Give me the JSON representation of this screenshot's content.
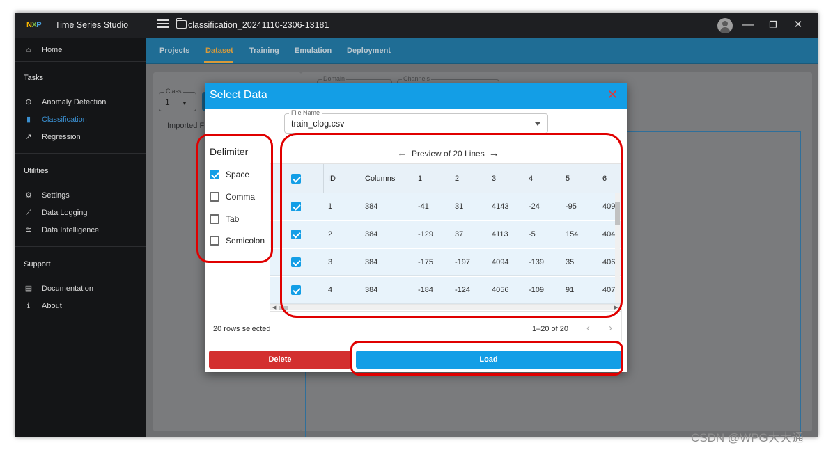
{
  "app": {
    "logo_text": "NXP",
    "title": "Time Series Studio",
    "project_name": "classification_20241110-2306-13181"
  },
  "window_controls": {
    "minimize": "—",
    "maximize": "❐",
    "close": "✕"
  },
  "sidebar": {
    "home": "Home",
    "tasks_header": "Tasks",
    "tasks": [
      "Anomaly Detection",
      "Classification",
      "Regression"
    ],
    "utilities_header": "Utilities",
    "utilities": [
      "Settings",
      "Data Logging",
      "Data Intelligence"
    ],
    "support_header": "Support",
    "support": [
      "Documentation",
      "About"
    ],
    "active_item": "Classification"
  },
  "tabs": [
    "Projects",
    "Dataset",
    "Training",
    "Emulation",
    "Deployment"
  ],
  "active_tab": "Dataset",
  "background": {
    "class_label": "Class",
    "class_value": "1",
    "imported_label": "Imported F",
    "domain_label": "Domain",
    "channels_label": "Channels"
  },
  "dialog": {
    "title": "Select Data",
    "file_name_label": "File Name",
    "file_name_value": "train_clog.csv",
    "delimiter_title": "Delimiter",
    "delimiters": [
      {
        "label": "Space",
        "checked": true
      },
      {
        "label": "Comma",
        "checked": false
      },
      {
        "label": "Tab",
        "checked": false
      },
      {
        "label": "Semicolon",
        "checked": false
      }
    ],
    "preview_label": "Preview of 20 Lines",
    "grid": {
      "columns": [
        "ID",
        "Columns",
        "1",
        "2",
        "3",
        "4",
        "5",
        "6"
      ],
      "rows": [
        [
          "1",
          "384",
          "-41",
          "31",
          "4143",
          "-24",
          "-95",
          "409"
        ],
        [
          "2",
          "384",
          "-129",
          "37",
          "4113",
          "-5",
          "154",
          "404"
        ],
        [
          "3",
          "384",
          "-175",
          "-197",
          "4094",
          "-139",
          "35",
          "406"
        ],
        [
          "4",
          "384",
          "-184",
          "-124",
          "4056",
          "-109",
          "91",
          "407"
        ]
      ]
    },
    "rows_selected": "20 rows selected",
    "pagination": "1–20 of 20",
    "delete_label": "Delete",
    "load_label": "Load"
  },
  "watermark": "CSDN @WPG大大通",
  "colors": {
    "accent": "#139ee6",
    "danger": "#d32f2f",
    "annotation": "#e00000",
    "tab_active": "#d89a3a"
  }
}
